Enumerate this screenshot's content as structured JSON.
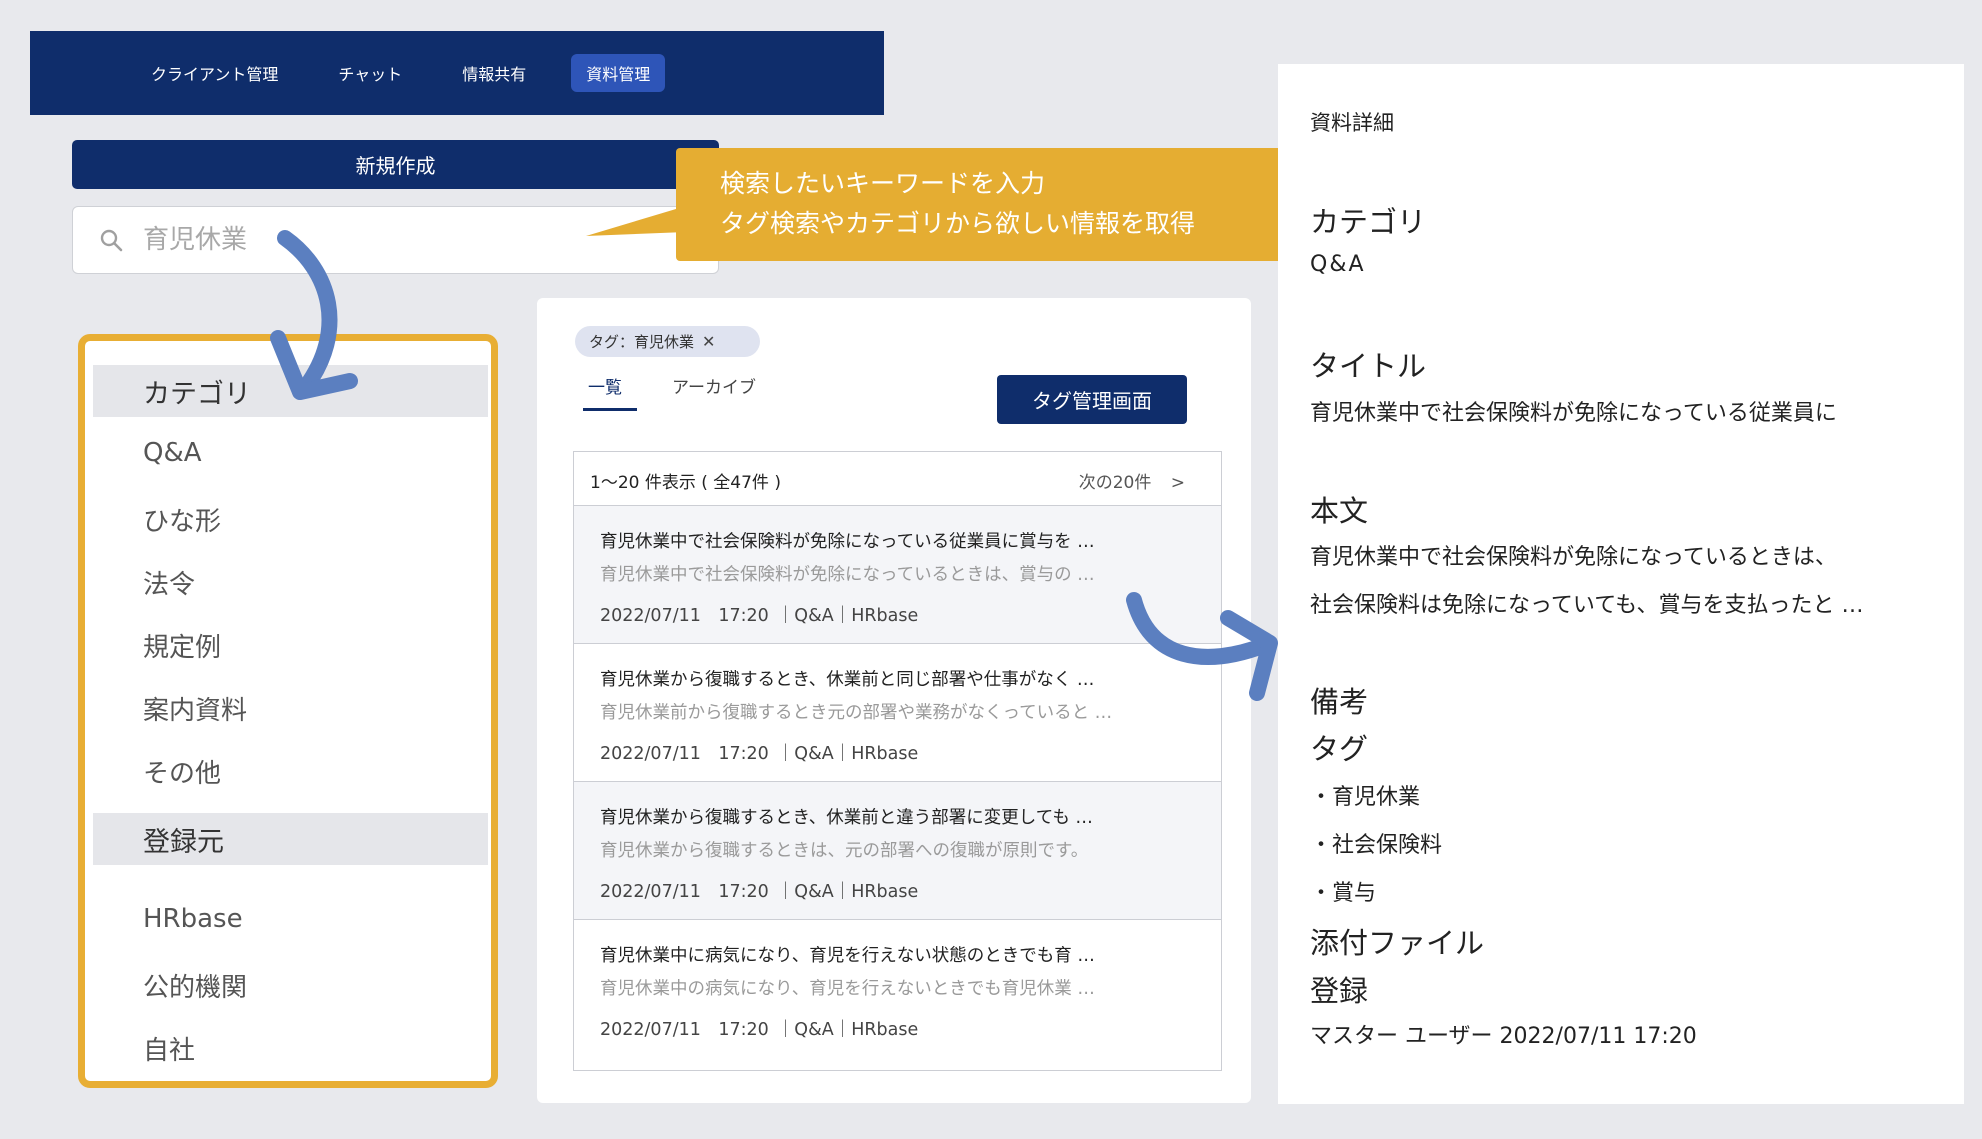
{
  "nav": {
    "items": [
      {
        "label": "クライアント管理"
      },
      {
        "label": "チャット"
      },
      {
        "label": "情報共有"
      },
      {
        "label": "資料管理",
        "active": true
      }
    ]
  },
  "new_button": "新規作成",
  "search": {
    "placeholder": "育児休業"
  },
  "tooltip": {
    "line1": "検索したいキーワードを入力",
    "line2": "タグ検索やカテゴリから欲しい情報を取得"
  },
  "filters": {
    "category_header": "カテゴリ",
    "categories": [
      "Q&A",
      "ひな形",
      "法令",
      "規定例",
      "案内資料",
      "その他"
    ],
    "source_header": "登録元",
    "sources": [
      "HRbase",
      "公的機関",
      "自社"
    ]
  },
  "tag_chip": {
    "label": "タグ：育児休業",
    "remove": "✕"
  },
  "tabs": [
    "一覧",
    "アーカイブ"
  ],
  "tag_manage_button": "タグ管理画面",
  "list": {
    "count_text": "1～20 件表示 ( 全47件 )",
    "next_text": "次の20件",
    "next_icon": ">",
    "rows": [
      {
        "title": "育児休業中で社会保険料が免除になっている従業員に賞与を …",
        "snippet": "育児休業中で社会保険料が免除になっているときは、賞与の …",
        "date": "2022/07/11　17:20",
        "meta": "｜Q&A｜HRbase"
      },
      {
        "title": "育児休業から復職するとき、休業前と同じ部署や仕事がなく …",
        "snippet": "育児休業前から復職するとき元の部署や業務がなくっていると …",
        "date": "2022/07/11　17:20",
        "meta": "｜Q&A｜HRbase"
      },
      {
        "title": "育児休業から復職するとき、休業前と違う部署に変更しても …",
        "snippet": "育児休業から復職するときは、元の部署への復職が原則です。",
        "date": "2022/07/11　17:20",
        "meta": "｜Q&A｜HRbase"
      },
      {
        "title": "育児休業中に病気になり、育児を行えない状態のときでも育 …",
        "snippet": "育児休業中の病気になり、育児を行えないときでも育児休業 …",
        "date": "2022/07/11　17:20",
        "meta": "｜Q&A｜HRbase"
      }
    ]
  },
  "detail": {
    "heading": "資料詳細",
    "category_label": "カテゴリ",
    "category_value": "Q&A",
    "title_label": "タイトル",
    "title_value": "育児休業中で社会保険料が免除になっている従業員に",
    "body_label": "本文",
    "body_line1": "育児休業中で社会保険料が免除になっているときは、",
    "body_line2": "社会保険料は免除になっていても、賞与を支払ったと …",
    "remarks_label": "備考",
    "tags_label": "タグ",
    "tags": [
      "・育児休業",
      "・社会保険料",
      "・賞与"
    ],
    "attachment_label": "添付ファイル",
    "registration_label": "登録",
    "registration_value": "マスター ユーザー 2022/07/11 17:20"
  },
  "colors": {
    "navy": "#0f2d6b",
    "accent_orange": "#e5ad32",
    "arrow_blue": "#5b7fc0",
    "background": "#e8e9ed"
  },
  "icons": [
    "search-icon",
    "close-icon",
    "chevron-right-icon",
    "curved-arrow-icon"
  ]
}
